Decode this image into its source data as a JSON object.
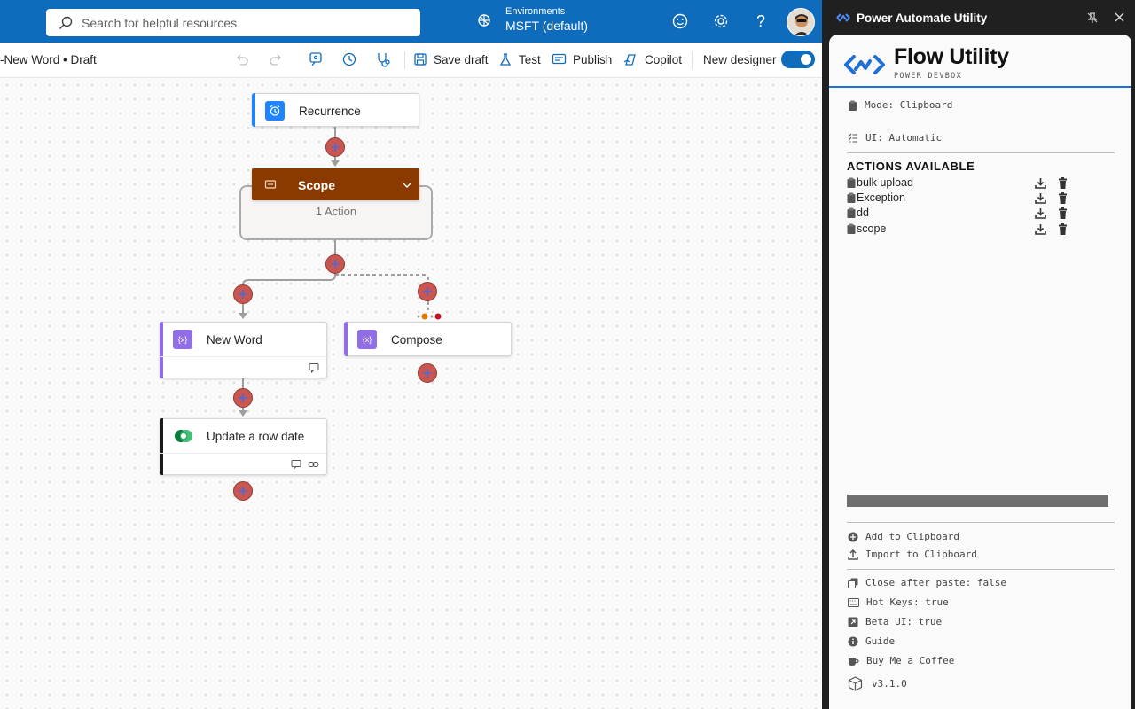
{
  "topbar": {
    "search_placeholder": "Search for helpful resources",
    "environment_label": "Environments",
    "environment_value": "MSFT (default)",
    "color": "#0f6cbd"
  },
  "cmdbar": {
    "breadcrumb": "-New Word",
    "status": "Draft",
    "save_draft": "Save draft",
    "test": "Test",
    "publish": "Publish",
    "copilot": "Copilot",
    "new_designer": "New designer"
  },
  "flow": {
    "recurrence": "Recurrence",
    "scope": "Scope",
    "scope_sub": "1 Action",
    "new_word": "New Word",
    "compose": "Compose",
    "update_row": "Update a row date",
    "scope_color": "#8a3a00",
    "expression_color": "#8f6ee8"
  },
  "panel": {
    "title": "Power Automate Utility",
    "brand": "Flow Utility",
    "brand_sub": "POWER DEVBOX",
    "mode": "Mode: Clipboard",
    "ui": "UI: Automatic",
    "actions_heading": "ACTIONS AVAILABLE",
    "actions": [
      "bulk upload",
      "Exception",
      "dd",
      "scope"
    ],
    "add_clipboard": "Add to Clipboard",
    "import_clipboard": "Import to Clipboard",
    "close_after_paste": "Close after paste: false",
    "hot_keys": "Hot Keys: true",
    "beta_ui": "Beta UI: true",
    "guide": "Guide",
    "coffee": "Buy Me a Coffee",
    "version": "v3.1.0"
  }
}
